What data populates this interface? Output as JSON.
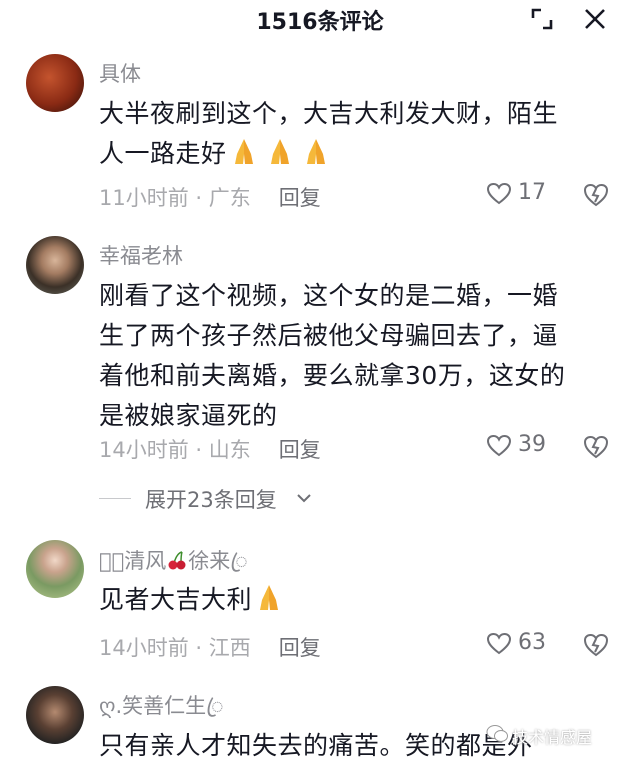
{
  "header": {
    "title": "1516条评论"
  },
  "comments": [
    {
      "username": "具体",
      "text": "大半夜刷到这个，大吉大利发大财，陌生人一路走好",
      "text_line1": "大半夜刷到这个，大吉大利发大财，陌生",
      "text_line2": "人一路走好",
      "time": "11小时前",
      "sep": " · ",
      "location": "广东",
      "reply": "回复",
      "likes": "17"
    },
    {
      "username": "幸福老林",
      "text_line1": "刚看了这个视频，这个女的是二婚，一婚",
      "text_line2": "生了两个孩子然后被他父母骗回去了，逼",
      "text_line3": "着他和前夫离婚，要么就拿30万，这女的",
      "text_line4": "是被娘家逼死的",
      "time": "14小时前",
      "sep": " · ",
      "location": "山东",
      "reply": "回复",
      "likes": "39",
      "expand_label": "展开23条回复"
    },
    {
      "username_a": "𝓜ꦿ清风",
      "username_b": "徐来ꦿ",
      "text": "见者大吉大利",
      "time": "14小时前",
      "sep": " · ",
      "location": "江西",
      "reply": "回复",
      "likes": "63"
    },
    {
      "username": "ღ.笑善仁生ꦿ",
      "text": "只有亲人才知失去的痛苦。笑的都是外"
    }
  ],
  "watermark": "技术情感屋",
  "icons": [
    "expand-icon",
    "close-icon",
    "heart-icon",
    "dislike-heart-icon",
    "chevron-down-icon",
    "folded-hands-emoji",
    "cherry-emoji",
    "wechat-icon"
  ]
}
